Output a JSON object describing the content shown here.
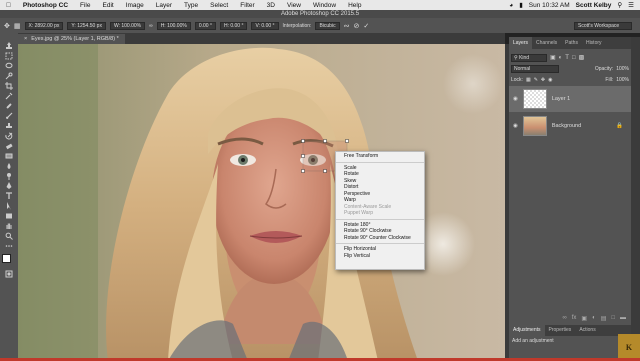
{
  "menubar": {
    "app": "Photoshop CC",
    "items": [
      "File",
      "Edit",
      "Image",
      "Layer",
      "Type",
      "Select",
      "Filter",
      "3D",
      "View",
      "Window",
      "Help"
    ],
    "clock": "Sun 10:32 AM",
    "user": "Scott Kelby"
  },
  "app_title": "Adobe Photoshop CC 2015.5",
  "options_bar": {
    "x": "X: 2892.00 px",
    "y": "Y: 1254.50 px",
    "w": "W: 100.00%",
    "h": "H: 100.00%",
    "angle": "0.00 °",
    "hskew": "H: 0.00 °",
    "vskew": "V: 0.00 °",
    "interp_label": "Interpolation:",
    "interp_value": "Bicubic",
    "workspace": "Scott's Workspace"
  },
  "doc_tab": {
    "title": "Eyes.jpg @ 25% (Layer 1, RGB/8) *",
    "close": "×"
  },
  "context_menu": {
    "groups": [
      [
        {
          "label": "Free Transform",
          "enabled": true
        }
      ],
      [
        {
          "label": "Scale",
          "enabled": true
        },
        {
          "label": "Rotate",
          "enabled": true
        },
        {
          "label": "Skew",
          "enabled": true
        },
        {
          "label": "Distort",
          "enabled": true
        },
        {
          "label": "Perspective",
          "enabled": true
        },
        {
          "label": "Warp",
          "enabled": true
        },
        {
          "label": "Content-Aware Scale",
          "enabled": false
        },
        {
          "label": "Puppet Warp",
          "enabled": false
        }
      ],
      [
        {
          "label": "Rotate 180°",
          "enabled": true
        },
        {
          "label": "Rotate 90° Clockwise",
          "enabled": true
        },
        {
          "label": "Rotate 90° Counter Clockwise",
          "enabled": true
        }
      ],
      [
        {
          "label": "Flip Horizontal",
          "enabled": true
        },
        {
          "label": "Flip Vertical",
          "enabled": true
        }
      ]
    ]
  },
  "layers_panel": {
    "tabs": [
      "Layers",
      "Channels",
      "Paths",
      "History"
    ],
    "kind": "Kind",
    "blend_mode": "Normal",
    "opacity_label": "Opacity:",
    "opacity_value": "100%",
    "lock_label": "Lock:",
    "fill_label": "Fill:",
    "fill_value": "100%",
    "layers": [
      {
        "name": "Layer 1",
        "selected": true
      },
      {
        "name": "Background",
        "selected": false
      }
    ],
    "footer_icon": "fx"
  },
  "adjustments_panel": {
    "tabs": [
      "Adjustments",
      "Properties",
      "Actions"
    ],
    "add_label": "Add an adjustment"
  },
  "logo_text": "K"
}
